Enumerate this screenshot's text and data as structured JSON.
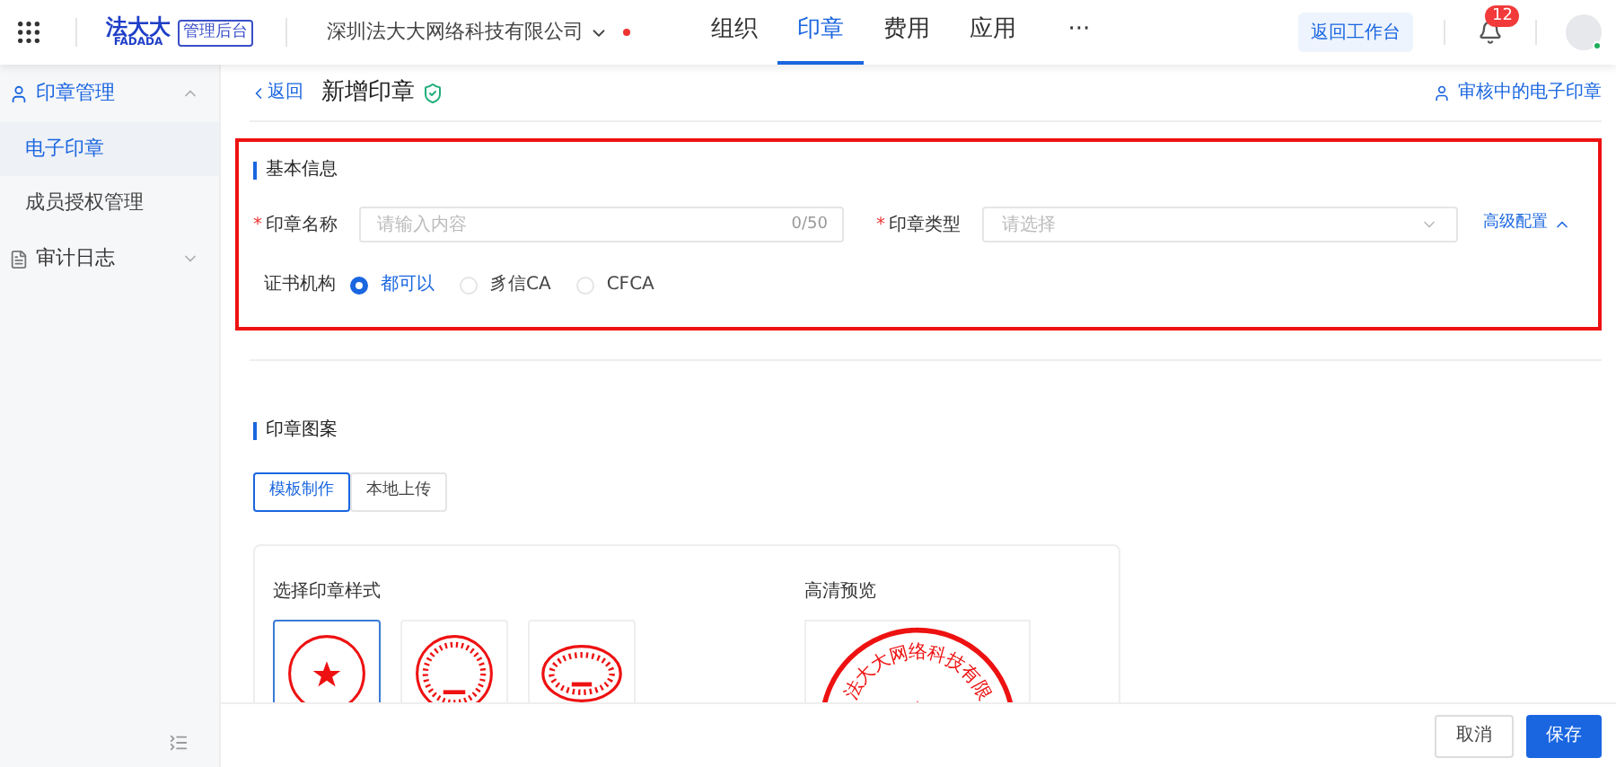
{
  "header": {
    "logo": {
      "name": "法大大",
      "latin": "FADADA",
      "badge": "管理后台"
    },
    "company": {
      "name": "深圳法大大网络科技有限公司",
      "alert": true
    },
    "nav": [
      {
        "label": "组织",
        "selected": false
      },
      {
        "label": "印章",
        "selected": true
      },
      {
        "label": "费用",
        "selected": false
      },
      {
        "label": "应用",
        "selected": false
      },
      {
        "label": "···",
        "selected": false
      }
    ],
    "workspace_button": "返回工作台",
    "notifications": "12",
    "avatar_online": true
  },
  "sidebar": {
    "items": [
      {
        "label": "印章管理",
        "expanded": true,
        "children": [
          {
            "label": "电子印章",
            "selected": true
          },
          {
            "label": "成员授权管理",
            "selected": false
          }
        ]
      },
      {
        "label": "审计日志",
        "expanded": false
      }
    ]
  },
  "page": {
    "back": "返回",
    "title": "新增印章",
    "pending_link": "审核中的电子印章"
  },
  "basic_info": {
    "heading": "基本信息",
    "highlighted": true,
    "name_field": {
      "label": "印章名称",
      "required_mark": "*",
      "placeholder": "请输入内容",
      "counter": "0/50"
    },
    "type_field": {
      "label": "印章类型",
      "required_mark": "*",
      "placeholder": "请选择"
    },
    "advanced": "高级配置",
    "ca": {
      "label": "证书机构",
      "options": [
        {
          "label": "都可以",
          "selected": true
        },
        {
          "label": "豸信CA",
          "selected": false
        },
        {
          "label": "CFCA",
          "selected": false
        }
      ]
    }
  },
  "pattern": {
    "heading": "印章图案",
    "tabs": [
      {
        "label": "模板制作",
        "selected": true
      },
      {
        "label": "本地上传",
        "selected": false
      }
    ],
    "styles_title": "选择印章样式",
    "styles": [
      {
        "kind": "round_star",
        "selected": true
      },
      {
        "kind": "round_text",
        "selected": false
      },
      {
        "kind": "oval",
        "selected": false
      }
    ],
    "preview_title": "高清预览",
    "preview_text": "法大大网络科技有限"
  },
  "footer": {
    "buttons": [
      {
        "label": "取消",
        "kind": "secondary"
      },
      {
        "label": "保存",
        "kind": "primary"
      }
    ]
  }
}
